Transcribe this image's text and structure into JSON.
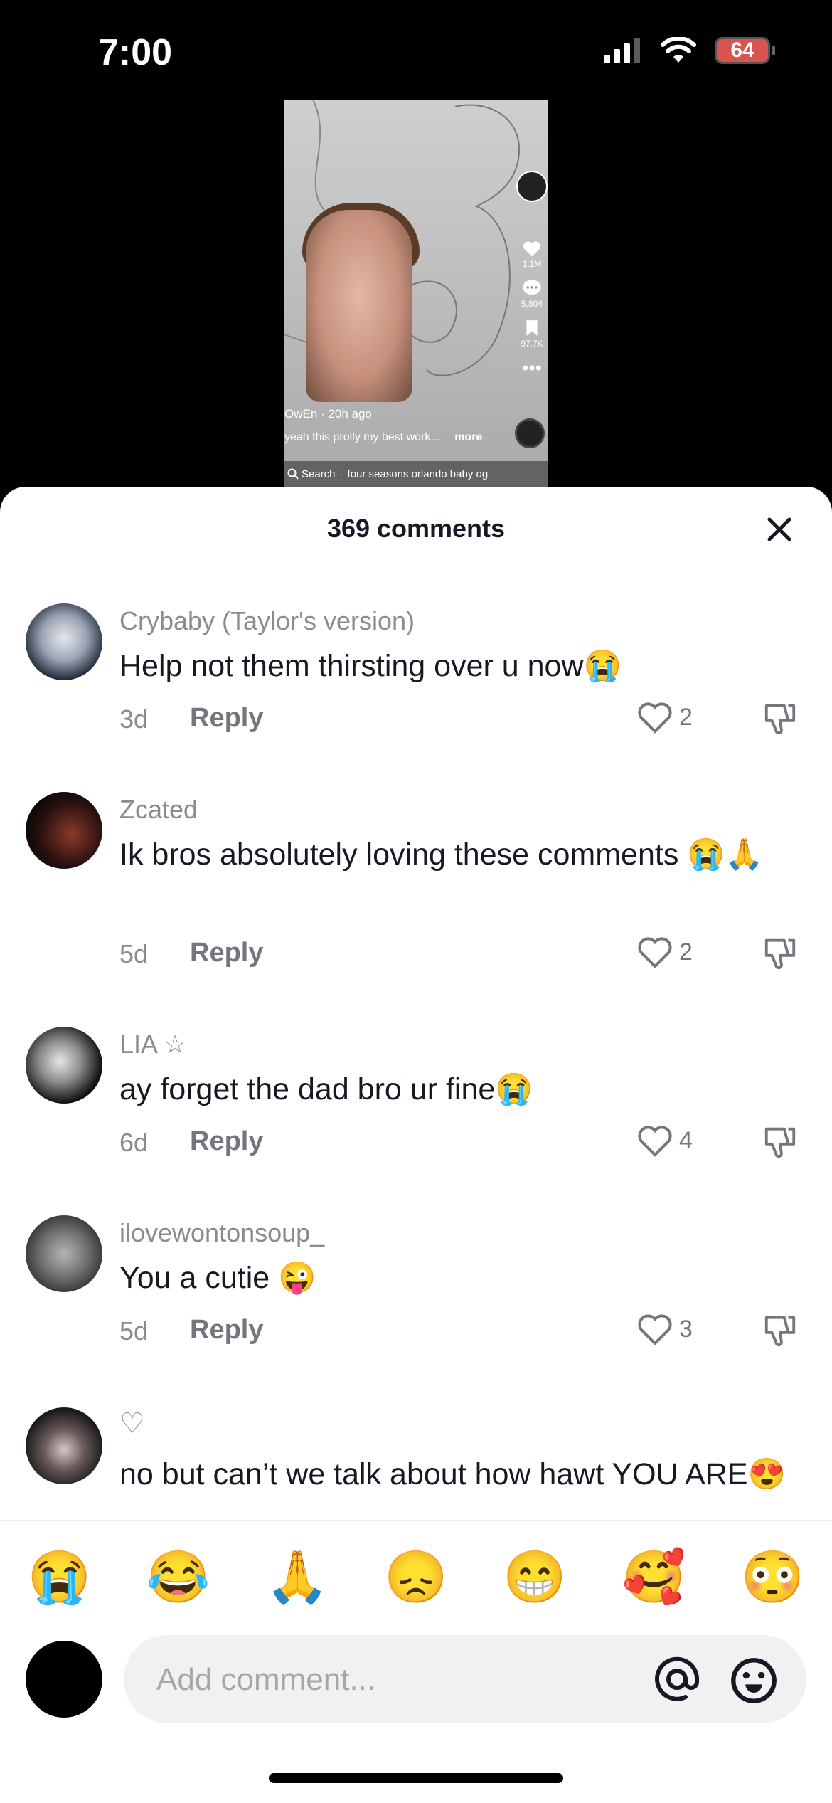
{
  "status": {
    "time": "7:00",
    "battery": "64"
  },
  "video": {
    "like_count": "1.1M",
    "comment_count": "5,804",
    "save_count": "97.7K",
    "author": "OwEn",
    "posted": "20h ago",
    "caption": "yeah this prolly my best work...",
    "more_label": "more",
    "search_label": "Search",
    "search_query": "four seasons orlando baby og"
  },
  "sheet": {
    "title": "369 comments"
  },
  "comments": [
    {
      "username": "Crybaby (Taylor's version)",
      "text": "Help not them thirsting over u now😭",
      "age": "3d",
      "reply": "Reply",
      "likes": "2"
    },
    {
      "username": "Zcated",
      "text": "Ik bros absolutely loving these comments 😭🙏",
      "age": "5d",
      "reply": "Reply",
      "likes": "2"
    },
    {
      "username": "LIA ☆",
      "text": "ay forget the dad bro ur fine😭",
      "age": "6d",
      "reply": "Reply",
      "likes": "4"
    },
    {
      "username": "ilovewontonsoup_",
      "text": "You a cutie 😜",
      "age": "5d",
      "reply": "Reply",
      "likes": "3"
    },
    {
      "username": "♡",
      "text": "no but can’t we talk about how hawt YOU ARE😍"
    }
  ],
  "emoji_bar": [
    "😭",
    "😂",
    "🙏",
    "😞",
    "😁",
    "🥰",
    "😳"
  ],
  "input": {
    "placeholder": "Add comment..."
  },
  "colors": {
    "battery": "#d9534f",
    "muted_text": "#8a8b91",
    "input_bg": "#f1f1f2"
  }
}
